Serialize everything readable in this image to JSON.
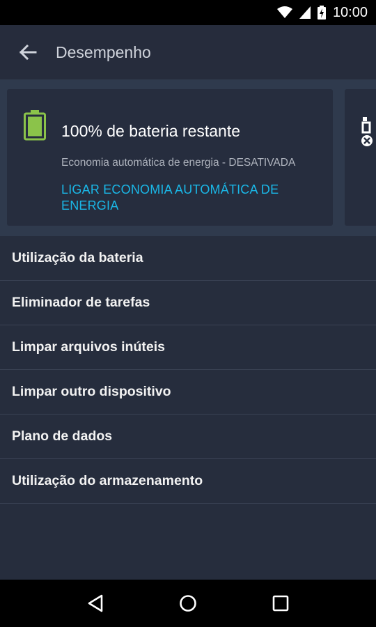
{
  "status_bar": {
    "time": "10:00",
    "icons": [
      "wifi-icon",
      "signal-icon",
      "battery-charging-icon"
    ]
  },
  "app_bar": {
    "title": "Desempenho",
    "back_icon": "arrow-back-icon"
  },
  "battery_card": {
    "icon": "battery-full-icon",
    "title": "100% de bateria restante",
    "subtitle": "Economia automática de energia - DESATIVADA",
    "action": "LIGAR ECONOMIA AUTOMÁTICA DE ENERGIA",
    "battery_level": 1.0
  },
  "menu": {
    "items": [
      {
        "label": "Utilização da bateria"
      },
      {
        "label": "Eliminador de tarefas"
      },
      {
        "label": "Limpar arquivos inúteis"
      },
      {
        "label": "Limpar outro dispositivo"
      },
      {
        "label": "Plano de dados"
      },
      {
        "label": "Utilização do armazenamento"
      }
    ]
  },
  "nav_bar": {
    "icons": [
      "back-triangle-icon",
      "home-circle-icon",
      "recents-square-icon"
    ]
  },
  "colors": {
    "background": "#262d3d",
    "accent": "#1ab8e8",
    "battery_green": "#8bc34a"
  }
}
